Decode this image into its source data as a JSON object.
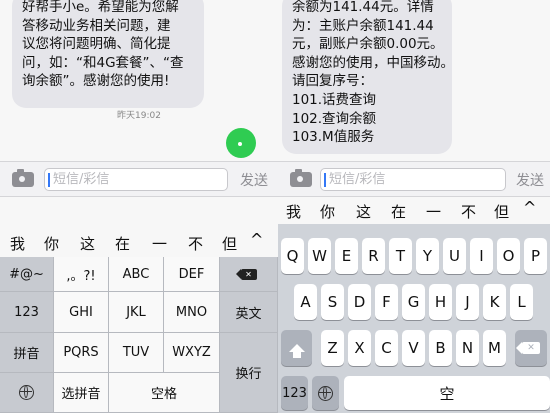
{
  "left": {
    "bubble_text": "好帮手小e。希望能为您解\n答移动业务相关问题，建\n议您将问题明确、简化提\n问，如：“和4G套餐”、“查\n询余额”。感谢您的使用!",
    "timestamp": "昨天19:02",
    "input_placeholder": "短信/彩信",
    "send_label": "发送",
    "candidates": [
      "我",
      "你",
      "这",
      "在",
      "一",
      "不",
      "但"
    ],
    "candidates_more": "^",
    "keys": {
      "symbols": "#@~",
      "punct": ",。?!",
      "abc": "ABC",
      "def": "DEF",
      "ghi": "GHI",
      "jkl": "JKL",
      "mno": "MNO",
      "pqrs": "PQRS",
      "tuv": "TUV",
      "wxyz": "WXYZ",
      "num": "123",
      "pinyin": "拼音",
      "english": "英文",
      "select_pinyin": "选拼音",
      "space": "空格",
      "return": "换行"
    }
  },
  "right": {
    "bubble_text": "余额为141.44元。详情\n为：主账户余额141.44\n元，副账户余额0.00元。\n感谢您的使用，中国移动。\n请回复序号：\n101.话费查询\n102.查询余额\n103.M值服务",
    "input_placeholder": "短信/彩信",
    "send_label": "发送",
    "candidates": [
      "我",
      "你",
      "这",
      "在",
      "一",
      "不",
      "但"
    ],
    "candidates_more": "^",
    "row1": [
      "Q",
      "W",
      "E",
      "R",
      "T",
      "Y",
      "U",
      "I",
      "O",
      "P"
    ],
    "row2": [
      "A",
      "S",
      "D",
      "F",
      "G",
      "H",
      "J",
      "K",
      "L"
    ],
    "row3": [
      "Z",
      "X",
      "C",
      "V",
      "B",
      "N",
      "M"
    ],
    "num": "123",
    "space_partial": "空"
  },
  "colors": {
    "sent_bubble": "#2fcc52",
    "received_bubble": "#e5e5ea",
    "cursor": "#3478f6"
  },
  "icons": [
    "camera-icon",
    "globe-icon",
    "shift-icon",
    "delete-icon",
    "chevron-up-icon"
  ]
}
